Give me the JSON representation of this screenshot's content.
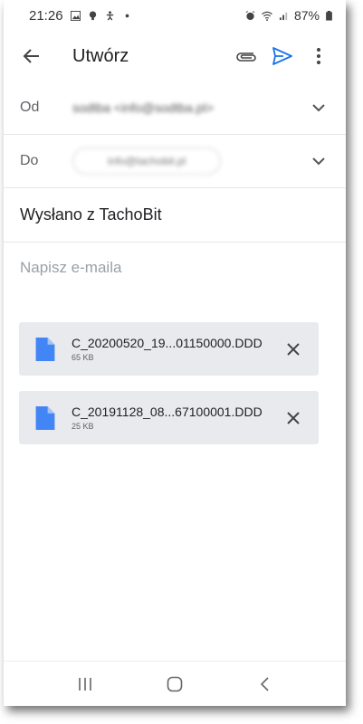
{
  "status_bar": {
    "time": "21:26",
    "battery": "87%",
    "left_icons": [
      "gallery-icon",
      "bulb-icon",
      "accessibility-icon",
      "dot-icon"
    ],
    "right_icons": [
      "alarm-icon",
      "wifi-icon",
      "signal-icon",
      "battery-icon"
    ]
  },
  "appbar": {
    "title": "Utwórz",
    "icons": [
      "back-arrow-icon",
      "attach-icon",
      "send-icon",
      "more-vert-icon"
    ],
    "send_color": "#1a73e8"
  },
  "from": {
    "label": "Od",
    "value": "sodtba <info@sodtba.pl>"
  },
  "to": {
    "label": "Do",
    "value": "info@tachobit.pl"
  },
  "subject": "Wysłano z TachoBit",
  "body_placeholder": "Napisz e-maila",
  "attachments": [
    {
      "name": "C_20200520_19...01150000.DDD",
      "size": "65 KB"
    },
    {
      "name": "C_20191128_08...67100001.DDD",
      "size": "25 KB"
    }
  ],
  "nav": [
    "recents-icon",
    "home-icon",
    "back-icon"
  ],
  "colors": {
    "file_icon": "#4285f4",
    "attachment_bg": "#e8eaed"
  }
}
